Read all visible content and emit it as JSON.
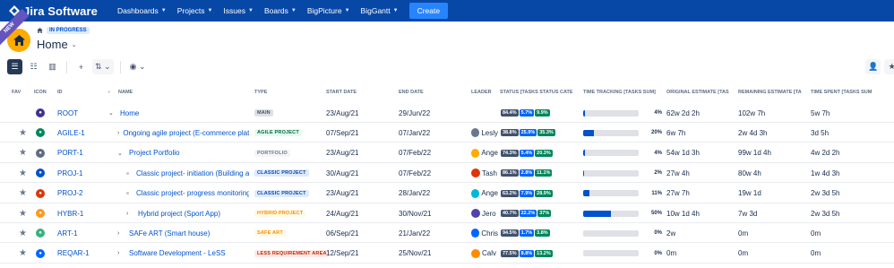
{
  "topbar": {
    "app_name": "Jira Software",
    "nav": [
      "Dashboards",
      "Projects",
      "Issues",
      "Boards",
      "BigPicture",
      "BigGantt"
    ],
    "create_label": "Create"
  },
  "ribbon": "NEW",
  "breadcrumb": {
    "status": "IN PROGRESS"
  },
  "page_title": "Home",
  "columns": [
    "FAV",
    "ICON",
    "ID",
    "NAME",
    "TYPE",
    "START DATE",
    "END DATE",
    "LEADER",
    "STATUS [TASKS STATUS CATE",
    "TIME TRACKING [TASKS SUM]",
    "ORIGINAL ESTIMATE [TAS",
    "REMAINING ESTIMATE [TA",
    "TIME SPENT [TASKS SUM"
  ],
  "colors": {
    "topbar": "#0747a6",
    "accent": "#0052cc"
  },
  "rows": [
    {
      "id": "ROOT",
      "name": "Home",
      "type": "MAIN",
      "type_color": "#dfe1e6",
      "type_text": "#42526e",
      "start": "23/Aug/21",
      "end": "29/Jun/22",
      "leader": "",
      "status": [
        "84.4%",
        "5.7%",
        "9.9%"
      ],
      "tracking": 0.04,
      "pct": "4%",
      "orig": "62w 2d 2h",
      "remaining": "102w 7h",
      "spent": "5w 7h",
      "icon_color": "#403294",
      "fav": false,
      "level": 0,
      "expander": "down"
    },
    {
      "id": "AGILE-1",
      "name": "Ongoing agile project (E-commerce plat",
      "type": "AGILE PROJECT",
      "type_color": "#e3fcef",
      "type_text": "#006644",
      "start": "07/Sep/21",
      "end": "07/Jan/22",
      "leader": "Lesly",
      "status": [
        "38.8%",
        "25.9%",
        "35.3%"
      ],
      "tracking": 0.2,
      "pct": "20%",
      "orig": "6w 7h",
      "remaining": "2w 4d 3h",
      "spent": "3d 5h",
      "icon_color": "#00875a",
      "fav": true,
      "level": 1,
      "expander": "right"
    },
    {
      "id": "PORT-1",
      "name": "Project Portfolio",
      "type": "PORTFOLIO",
      "type_color": "#f4f5f7",
      "type_text": "#6b778c",
      "start": "23/Aug/21",
      "end": "07/Feb/22",
      "leader": "Ange",
      "status": [
        "74.3%",
        "5.4%",
        "20.3%"
      ],
      "tracking": 0.04,
      "pct": "4%",
      "orig": "54w 1d 3h",
      "remaining": "99w 1d 4h",
      "spent": "4w 2d 2h",
      "icon_color": "#5e6c84",
      "fav": true,
      "level": 1,
      "expander": "down"
    },
    {
      "id": "PROJ-1",
      "name": "Classic project- initiation (Building a",
      "type": "CLASSIC PROJECT",
      "type_color": "#deebff",
      "type_text": "#0747a6",
      "start": "30/Aug/21",
      "end": "07/Feb/22",
      "leader": "Tash",
      "status": [
        "86.1%",
        "2.8%",
        "11.1%"
      ],
      "tracking": 0.02,
      "pct": "2%",
      "orig": "27w 4h",
      "remaining": "80w 4h",
      "spent": "1w 4d 3h",
      "icon_color": "#0052cc",
      "fav": true,
      "level": 2,
      "expander": "none"
    },
    {
      "id": "PROJ-2",
      "name": "Classic project- progress monitoring",
      "type": "CLASSIC PROJECT",
      "type_color": "#deebff",
      "type_text": "#0747a6",
      "start": "23/Aug/21",
      "end": "28/Jan/22",
      "leader": "Ange",
      "status": [
        "63.2%",
        "7.9%",
        "28.9%"
      ],
      "tracking": 0.11,
      "pct": "11%",
      "orig": "27w 7h",
      "remaining": "19w 1d",
      "spent": "2w 3d 5h",
      "icon_color": "#de350b",
      "fav": true,
      "level": 2,
      "expander": "none"
    },
    {
      "id": "HYBR-1",
      "name": "Hybrid project (Sport App)",
      "type": "HYBRID PROJECT",
      "type_color": "#fffae6",
      "type_text": "#ff8b00",
      "start": "24/Aug/21",
      "end": "30/Nov/21",
      "leader": "Jero",
      "status": [
        "40.7%",
        "22.2%",
        "37%"
      ],
      "tracking": 0.5,
      "pct": "50%",
      "orig": "10w 1d 4h",
      "remaining": "7w 3d",
      "spent": "2w 3d 5h",
      "icon_color": "#ff991f",
      "fav": true,
      "level": 2,
      "expander": "right"
    },
    {
      "id": "ART-1",
      "name": "SAFe ART (Smart house)",
      "type": "SAFE ART",
      "type_color": "#fffae6",
      "type_text": "#ff8b00",
      "start": "06/Sep/21",
      "end": "21/Jan/22",
      "leader": "Chris",
      "status": [
        "94.5%",
        "1.7%",
        "3.8%"
      ],
      "tracking": 0,
      "pct": "0%",
      "orig": "2w",
      "remaining": "0m",
      "spent": "0m",
      "icon_color": "#36b37e",
      "fav": true,
      "level": 1,
      "expander": "right"
    },
    {
      "id": "REQAR-1",
      "name": "Software Development - LeSS",
      "type": "LESS REQUIREMENT AREA",
      "type_color": "#ffebe6",
      "type_text": "#bf2600",
      "start": "12/Sep/21",
      "end": "25/Nov/21",
      "leader": "Calv",
      "status": [
        "77.5%",
        "8.8%",
        "13.2%"
      ],
      "tracking": 0,
      "pct": "0%",
      "orig": "0m",
      "remaining": "0m",
      "spent": "0m",
      "icon_color": "#0065ff",
      "fav": true,
      "level": 1,
      "expander": "right"
    }
  ]
}
